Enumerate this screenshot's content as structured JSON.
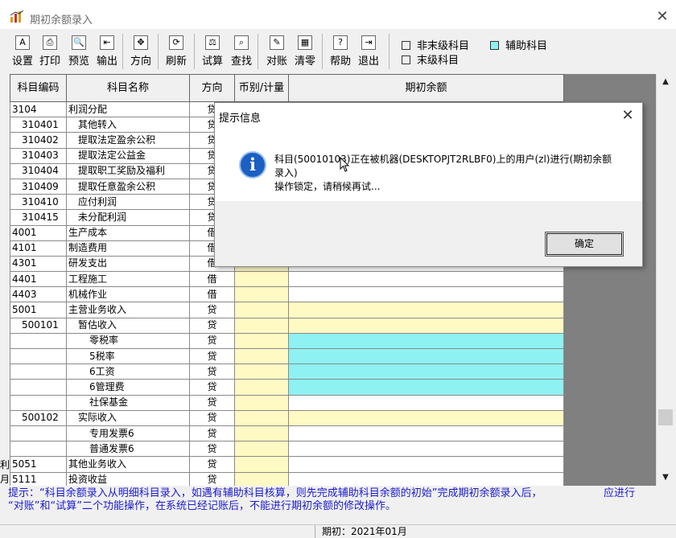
{
  "window": {
    "title": "期初余额录入",
    "close_glyph": "✕"
  },
  "toolbar": {
    "buttons": [
      {
        "label": "设置",
        "icon": "A",
        "icon_name": "settings-icon"
      },
      {
        "label": "打印",
        "icon": "⎙",
        "icon_name": "printer-icon"
      },
      {
        "label": "预览",
        "icon": "🔍",
        "icon_name": "preview-icon"
      },
      {
        "label": "输出",
        "icon": "⇤",
        "icon_name": "export-icon"
      },
      {
        "label": "方向",
        "icon": "✥",
        "icon_name": "direction-icon"
      },
      {
        "label": "刷新",
        "icon": "⟳",
        "icon_name": "refresh-icon"
      },
      {
        "label": "试算",
        "icon": "⚖",
        "icon_name": "balance-scale-icon"
      },
      {
        "label": "查找",
        "icon": "⌕",
        "icon_name": "find-icon"
      },
      {
        "label": "对账",
        "icon": "✎",
        "icon_name": "reconcile-icon"
      },
      {
        "label": "清零",
        "icon": "▦",
        "icon_name": "clear-icon"
      },
      {
        "label": "帮助",
        "icon": "?",
        "icon_name": "help-icon"
      },
      {
        "label": "退出",
        "icon": "⇥",
        "icon_name": "exit-icon"
      }
    ]
  },
  "legend": {
    "non_leaf": "非末级科目",
    "auxiliary": "辅助科目",
    "leaf": "末级科目",
    "colors": {
      "non_leaf": "#ffffff",
      "auxiliary": "#8ef2f2",
      "leaf": "#ffffff"
    }
  },
  "table": {
    "headers": [
      "科目编码",
      "科目名称",
      "方向",
      "币别/计量",
      "期初余额"
    ],
    "rows": [
      {
        "code": "3104",
        "name": "利润分配",
        "dir": "贷",
        "indent": 0
      },
      {
        "code": "310401",
        "name": "其他转入",
        "dir": "贷",
        "indent": 1
      },
      {
        "code": "310402",
        "name": "提取法定盈余公积",
        "dir": "贷",
        "indent": 1
      },
      {
        "code": "310403",
        "name": "提取法定公益金",
        "dir": "贷",
        "indent": 1
      },
      {
        "code": "310404",
        "name": "提取职工奖励及福利",
        "dir": "贷",
        "indent": 1
      },
      {
        "code": "310409",
        "name": "提取任意盈余公积",
        "dir": "贷",
        "indent": 1
      },
      {
        "code": "310410",
        "name": "应付利润",
        "dir": "贷",
        "indent": 1
      },
      {
        "code": "310415",
        "name": "未分配利润",
        "dir": "贷",
        "indent": 1
      },
      {
        "code": "4001",
        "name": "生产成本",
        "dir": "借",
        "indent": 0
      },
      {
        "code": "4101",
        "name": "制造费用",
        "dir": "借",
        "indent": 0
      },
      {
        "code": "4301",
        "name": "研发支出",
        "dir": "借",
        "indent": 0
      },
      {
        "code": "4401",
        "name": "工程施工",
        "dir": "借",
        "indent": 0
      },
      {
        "code": "4403",
        "name": "机械作业",
        "dir": "借",
        "indent": 0
      },
      {
        "code": "5001",
        "name": "主营业务收入",
        "dir": "贷",
        "indent": 0,
        "color": "yellow"
      },
      {
        "code": "500101",
        "name": "暂估收入",
        "dir": "贷",
        "indent": 1,
        "color": "yellow"
      },
      {
        "code": "",
        "name": "零税率",
        "dir": "贷",
        "indent": 2,
        "color": "cyan",
        "dotted": true
      },
      {
        "code": "",
        "name": "5税率",
        "dir": "贷",
        "indent": 2,
        "color": "cyan",
        "dotted": true
      },
      {
        "code": "",
        "name": "6工资",
        "dir": "贷",
        "indent": 2,
        "color": "cyan",
        "dotted": true
      },
      {
        "code": "",
        "name": "6管理费",
        "dir": "贷",
        "indent": 2,
        "color": "cyan",
        "dotted": true
      },
      {
        "code": "",
        "name": "社保基金",
        "dir": "贷",
        "indent": 2,
        "color": "white",
        "dotted": true
      },
      {
        "code": "500102",
        "name": "实际收入",
        "dir": "贷",
        "indent": 1,
        "color": "yellow"
      },
      {
        "code": "",
        "name": "专用发票6",
        "dir": "贷",
        "indent": 2,
        "color": "white",
        "dotted": true
      },
      {
        "code": "",
        "name": "普通发票6",
        "dir": "贷",
        "indent": 2,
        "color": "white",
        "dotted": true
      },
      {
        "code": "5051",
        "name": "其他业务收入",
        "dir": "贷",
        "indent": 0
      },
      {
        "code": "5111",
        "name": "投资收益",
        "dir": "贷",
        "indent": 0
      }
    ]
  },
  "scrollbar": {
    "up": "▲",
    "down": "▼"
  },
  "left_clipped": [
    "利",
    "月"
  ],
  "hint": {
    "line1": "提示：“科目余额录入从明细科目录入，如遇有辅助科目核算，则先完成辅助科目余额的初始”完成期初余额录入后，",
    "line1_tail": "应进行",
    "line2": "“对账”和“试算”二个功能操作，在系统已经记账后，不能进行期初余额的修改操作。"
  },
  "status": {
    "period": "期初：2021年01月"
  },
  "dialog": {
    "title": "提示信息",
    "close_glyph": "✕",
    "icon": "i",
    "message_line1": "科目(50010103)正在被机器(DESKTOPJT2RLBF0)上的用户(zl)进行(期初余额",
    "message_line2": "录入)",
    "message_line3": "操作锁定，请稍候再试...",
    "ok_label": "确定"
  }
}
